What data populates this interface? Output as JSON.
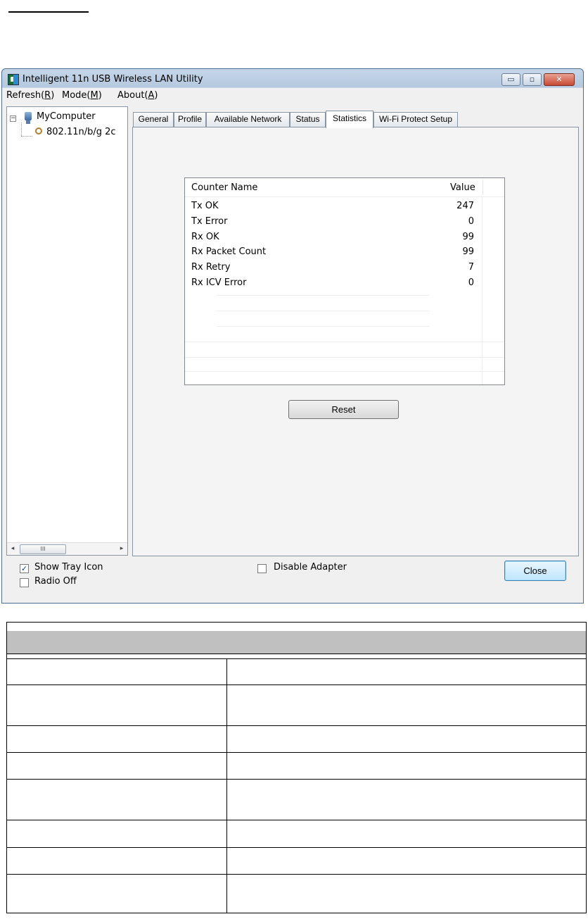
{
  "window": {
    "title": "Intelligent 11n USB Wireless LAN Utility",
    "controls": {
      "minimize": "▭",
      "maximize": "▫",
      "close": "✕"
    }
  },
  "menu": {
    "refresh": {
      "pre": "Refresh(",
      "key": "R",
      "post": ")"
    },
    "mode": {
      "pre": "Mode(",
      "key": "M",
      "post": ")"
    },
    "about": {
      "pre": "About(",
      "key": "A",
      "post": ")"
    }
  },
  "tree": {
    "expander": "−",
    "root": "MyComputer",
    "child": "802.11n/b/g 2c",
    "scroll_thumb": "III",
    "scroll_left": "◂",
    "scroll_right": "▸"
  },
  "tabs": [
    "General",
    "Profile",
    "Available Network",
    "Status",
    "Statistics",
    "Wi-Fi Protect Setup"
  ],
  "active_tab": "Statistics",
  "stats": {
    "header": {
      "name": "Counter Name",
      "value": "Value"
    },
    "rows": [
      {
        "name": "Tx OK",
        "value": "247"
      },
      {
        "name": "Tx Error",
        "value": "0"
      },
      {
        "name": "Rx OK",
        "value": "99"
      },
      {
        "name": "Rx Packet Count",
        "value": "99"
      },
      {
        "name": "Rx Retry",
        "value": "7"
      },
      {
        "name": "Rx ICV Error",
        "value": "0"
      }
    ]
  },
  "buttons": {
    "reset": "Reset",
    "close": "Close"
  },
  "options": {
    "show_tray_icon": {
      "label": "Show Tray Icon",
      "checked": true,
      "mark": "✓"
    },
    "radio_off": {
      "label": "Radio Off",
      "checked": false
    },
    "disable_adapter": {
      "label": "Disable Adapter",
      "checked": false
    }
  },
  "colors": {
    "header_fill": "#c0c0c0",
    "title_bar": "#b4c8df",
    "close_button": "#bee6fd"
  }
}
